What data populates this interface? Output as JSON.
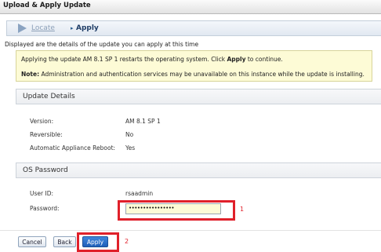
{
  "window": {
    "title": "Upload & Apply Update"
  },
  "breadcrumb": {
    "locate": "Locate",
    "separator": "▸",
    "apply": "Apply"
  },
  "subtitle": "Displayed are the details of the update you can apply at this time",
  "info": {
    "line1_prefix": "Applying the update AM 8.1 SP 1 restarts the operating system. Click ",
    "line1_bold": "Apply",
    "line1_suffix": " to continue.",
    "note_label": "Note:",
    "note_text": " Administration and authentication services may be unavailable on this instance while the update is installing."
  },
  "update_details": {
    "heading": "Update Details",
    "rows": [
      {
        "label": "Version:",
        "value": "AM 8.1 SP 1"
      },
      {
        "label": "Reversible:",
        "value": "No"
      },
      {
        "label": "Automatic Appliance Reboot:",
        "value": "Yes"
      }
    ]
  },
  "os_password": {
    "heading": "OS Password",
    "user_id_label": "User ID:",
    "user_id_value": "rsaadmin",
    "password_label": "Password:",
    "password_value": "••••••••••••••••"
  },
  "annotations": {
    "marker1": "1",
    "marker2": "2",
    "color": "#e0202a"
  },
  "buttons": {
    "cancel": "Cancel",
    "back": "Back",
    "apply": "Apply"
  }
}
